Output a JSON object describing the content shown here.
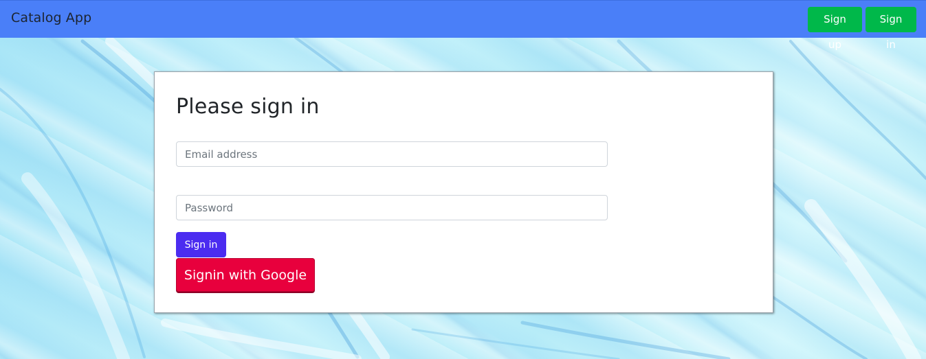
{
  "navbar": {
    "brand": "Catalog App",
    "signup_label": "Sign up",
    "signin_label": "Sign in"
  },
  "login_card": {
    "title": "Please sign in",
    "email_placeholder": "Email address",
    "password_placeholder": "Password",
    "signin_button_label": "Sign in",
    "google_button_label": "Signin with Google"
  },
  "colors": {
    "navbar_bg": "#4a7ff8",
    "nav_button_bg": "#00b84a",
    "signin_button_bg": "#4b2cf0",
    "google_button_bg": "#e8003d"
  }
}
